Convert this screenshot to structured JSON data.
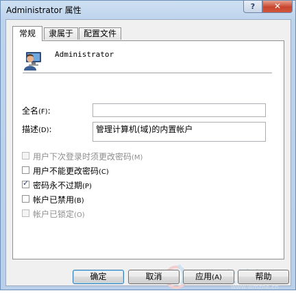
{
  "window": {
    "title": "Administrator 属性",
    "help_button": "?",
    "close_button": "✕"
  },
  "tabs": [
    {
      "label": "常规",
      "active": true
    },
    {
      "label": "隶属于",
      "active": false
    },
    {
      "label": "配置文件",
      "active": false
    }
  ],
  "user": {
    "name": "Administrator",
    "icon": "user-account-icon"
  },
  "fields": {
    "fullname": {
      "label": "全名",
      "shortcut": "(F)",
      "colon": ":",
      "value": ""
    },
    "description": {
      "label": "描述",
      "shortcut": "(D)",
      "colon": ":",
      "value": "管理计算机(域)的内置帐户"
    }
  },
  "checkboxes": [
    {
      "label": "用户下次登录时须更改密码",
      "shortcut": "(M)",
      "checked": false,
      "enabled": false
    },
    {
      "label": "用户不能更改密码",
      "shortcut": "(C)",
      "checked": false,
      "enabled": true
    },
    {
      "label": "密码永不过期",
      "shortcut": "(P)",
      "checked": true,
      "enabled": true
    },
    {
      "label": "帐户已禁用",
      "shortcut": "(B)",
      "checked": false,
      "enabled": true
    },
    {
      "label": "帐户已锁定",
      "shortcut": "(O)",
      "checked": false,
      "enabled": false
    }
  ],
  "buttons": {
    "ok": {
      "label": "确定"
    },
    "cancel": {
      "label": "取消"
    },
    "apply": {
      "label": "应用",
      "shortcut": "(A)"
    },
    "help": {
      "label": "帮助"
    }
  },
  "watermark": {
    "text": "野火论坛",
    "sub": "www.wmzhe.cn"
  }
}
